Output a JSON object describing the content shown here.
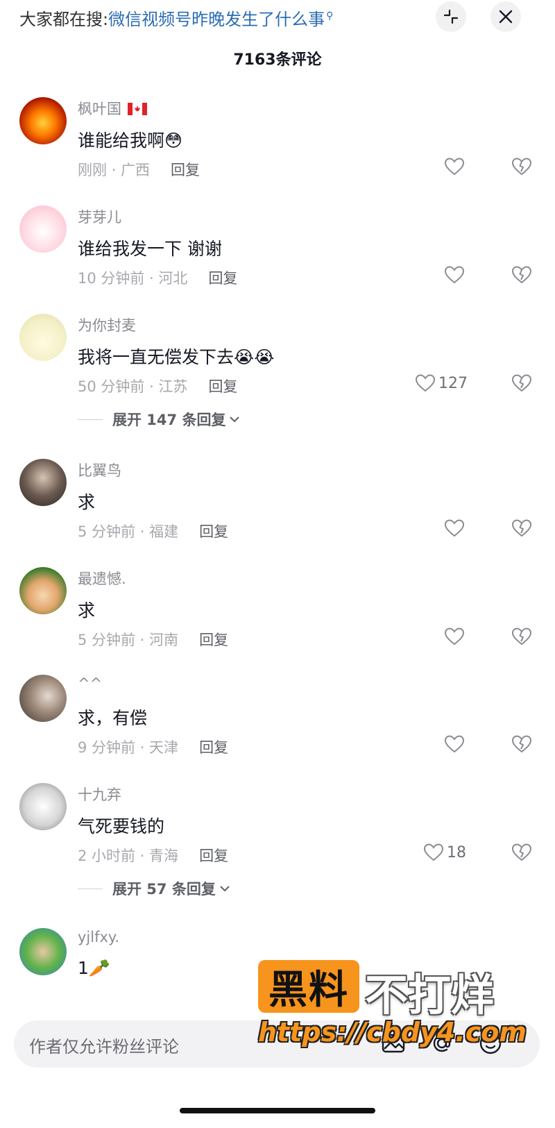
{
  "search": {
    "prefix": "大家都在搜:",
    "query": "微信视频号昨晚发生了什么事",
    "mini_icon": "search-icon"
  },
  "header": {
    "comment_count_title": "7163条评论",
    "collapse_icon": "collapse-icon",
    "close_icon": "close-icon"
  },
  "comments": [
    {
      "user": "枫叶国",
      "flag": "canada-flag-icon",
      "text": "谁能给我啊",
      "emoji": "😳",
      "meta": "刚刚 · 广西",
      "reply": "回复",
      "likes": ""
    },
    {
      "user": "芽芽儿",
      "text": "谁给我发一下 谢谢",
      "meta": "10 分钟前 · 河北",
      "reply": "回复",
      "likes": ""
    },
    {
      "user": "为你封麦",
      "text": "我将一直无偿发下去",
      "emoji": "😭😭",
      "meta": "50 分钟前 · 江苏",
      "reply": "回复",
      "likes": "127",
      "expand": "展开 147 条回复"
    },
    {
      "user": "比翼鸟",
      "text": "求",
      "meta": "5 分钟前 · 福建",
      "reply": "回复",
      "likes": ""
    },
    {
      "user": "最遗憾.",
      "text": "求",
      "meta": "5 分钟前 · 河南",
      "reply": "回复",
      "likes": ""
    },
    {
      "user": "^^",
      "text": "求，有偿",
      "meta": "9 分钟前 · 天津",
      "reply": "回复",
      "likes": ""
    },
    {
      "user": "十九弃",
      "text": "气死要钱的",
      "meta": "2 小时前 · 青海",
      "reply": "回复",
      "likes": "18",
      "expand": "展开 57 条回复"
    },
    {
      "user": "yjlfxy.",
      "text": "1",
      "emoji": "🥕",
      "meta": "",
      "reply": "",
      "likes": ""
    }
  ],
  "watermark": {
    "box": "黑料",
    "text": "不打烊",
    "url": "https://cbdy4.com",
    "color": "#f7941d"
  },
  "input": {
    "placeholder": "作者仅允许粉丝评论",
    "icons": [
      "image-icon",
      "at-icon",
      "emoji-icon"
    ]
  }
}
